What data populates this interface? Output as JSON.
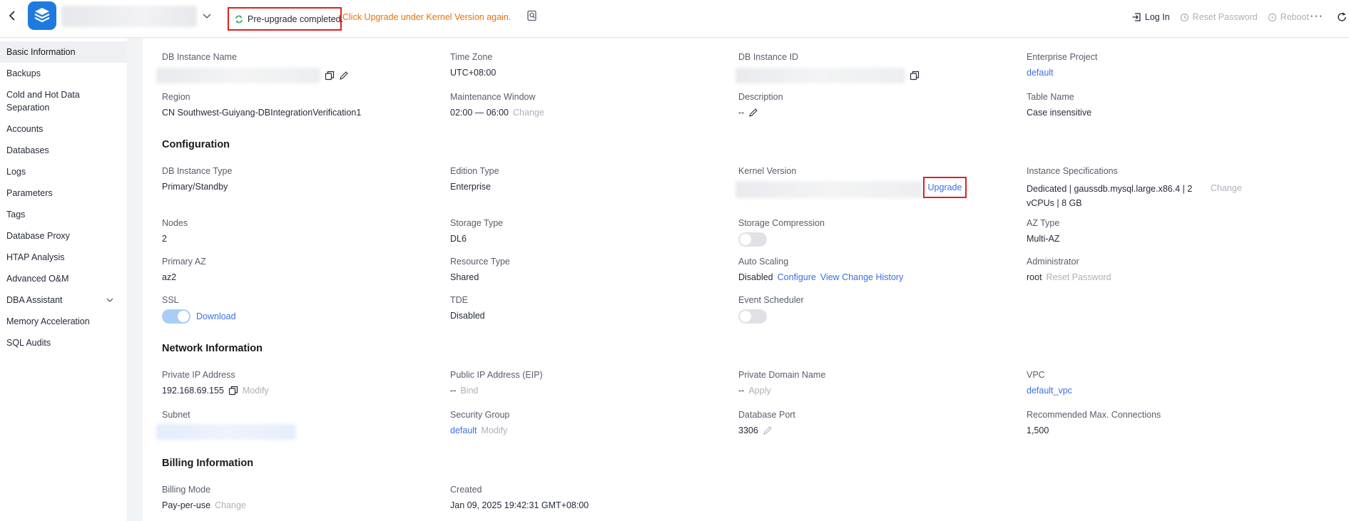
{
  "header": {
    "status_text": "Pre-upgrade completed.",
    "hint_text": "Click Upgrade under Kernel Version again.",
    "login": "Log In",
    "reset_password": "Reset Password",
    "reboot": "Reboot",
    "more": "···"
  },
  "sidebar": {
    "items": [
      {
        "label": "Basic Information"
      },
      {
        "label": "Backups"
      },
      {
        "label": "Cold and Hot Data Separation"
      },
      {
        "label": "Accounts"
      },
      {
        "label": "Databases"
      },
      {
        "label": "Logs"
      },
      {
        "label": "Parameters"
      },
      {
        "label": "Tags"
      },
      {
        "label": "Database Proxy"
      },
      {
        "label": "HTAP Analysis"
      },
      {
        "label": "Advanced O&M"
      },
      {
        "label": "DBA Assistant"
      },
      {
        "label": "Memory Acceleration"
      },
      {
        "label": "SQL Audits"
      }
    ]
  },
  "basic": {
    "db_instance_name_label": "DB Instance Name",
    "time_zone_label": "Time Zone",
    "time_zone": "UTC+08:00",
    "db_instance_id_label": "DB Instance ID",
    "enterprise_project_label": "Enterprise Project",
    "enterprise_project": "default",
    "region_label": "Region",
    "region": "CN Southwest-Guiyang-DBIntegrationVerification1",
    "maintenance_label": "Maintenance Window",
    "maintenance": "02:00 — 06:00",
    "change": "Change",
    "description_label": "Description",
    "description": "--",
    "table_name_label": "Table Name",
    "table_name": "Case insensitive"
  },
  "configuration": {
    "title": "Configuration",
    "instance_type_label": "DB Instance Type",
    "instance_type": "Primary/Standby",
    "edition_label": "Edition Type",
    "edition": "Enterprise",
    "kernel_label": "Kernel Version",
    "upgrade": "Upgrade",
    "specs_label": "Instance Specifications",
    "specs_line1": "Dedicated | gaussdb.mysql.large.x86.4 | 2",
    "specs_line2": "vCPUs | 8 GB",
    "specs_change": "Change",
    "nodes_label": "Nodes",
    "nodes": "2",
    "storage_type_label": "Storage Type",
    "storage_type": "DL6",
    "storage_compression_label": "Storage Compression",
    "az_type_label": "AZ Type",
    "az_type": "Multi-AZ",
    "primary_az_label": "Primary AZ",
    "primary_az": "az2",
    "resource_type_label": "Resource Type",
    "resource_type": "Shared",
    "auto_scaling_label": "Auto Scaling",
    "auto_scaling": "Disabled",
    "configure": "Configure",
    "view_change_history": "View Change History",
    "admin_label": "Administrator",
    "admin": "root",
    "reset_password": "Reset Password",
    "ssl_label": "SSL",
    "download": "Download",
    "tde_label": "TDE",
    "tde": "Disabled",
    "event_scheduler_label": "Event Scheduler"
  },
  "network": {
    "title": "Network Information",
    "private_ip_label": "Private IP Address",
    "private_ip": "192.168.69.155",
    "modify": "Modify",
    "public_ip_label": "Public IP Address (EIP)",
    "public_ip": "--",
    "bind": "Bind",
    "domain_label": "Private Domain Name",
    "domain": "--",
    "apply": "Apply",
    "vpc_label": "VPC",
    "vpc": "default_vpc",
    "subnet_label": "Subnet",
    "security_group_label": "Security Group",
    "security_group": "default",
    "port_label": "Database Port",
    "port": "3306",
    "max_conn_label": "Recommended Max. Connections",
    "max_conn": "1,500"
  },
  "billing": {
    "title": "Billing Information",
    "mode_label": "Billing Mode",
    "mode": "Pay-per-use",
    "change": "Change",
    "created_label": "Created",
    "created": "Jan 09, 2025 19:42:31 GMT+08:00"
  },
  "toggles": {
    "storage_compression_on": false,
    "ssl_on": true,
    "event_scheduler_on": false
  }
}
